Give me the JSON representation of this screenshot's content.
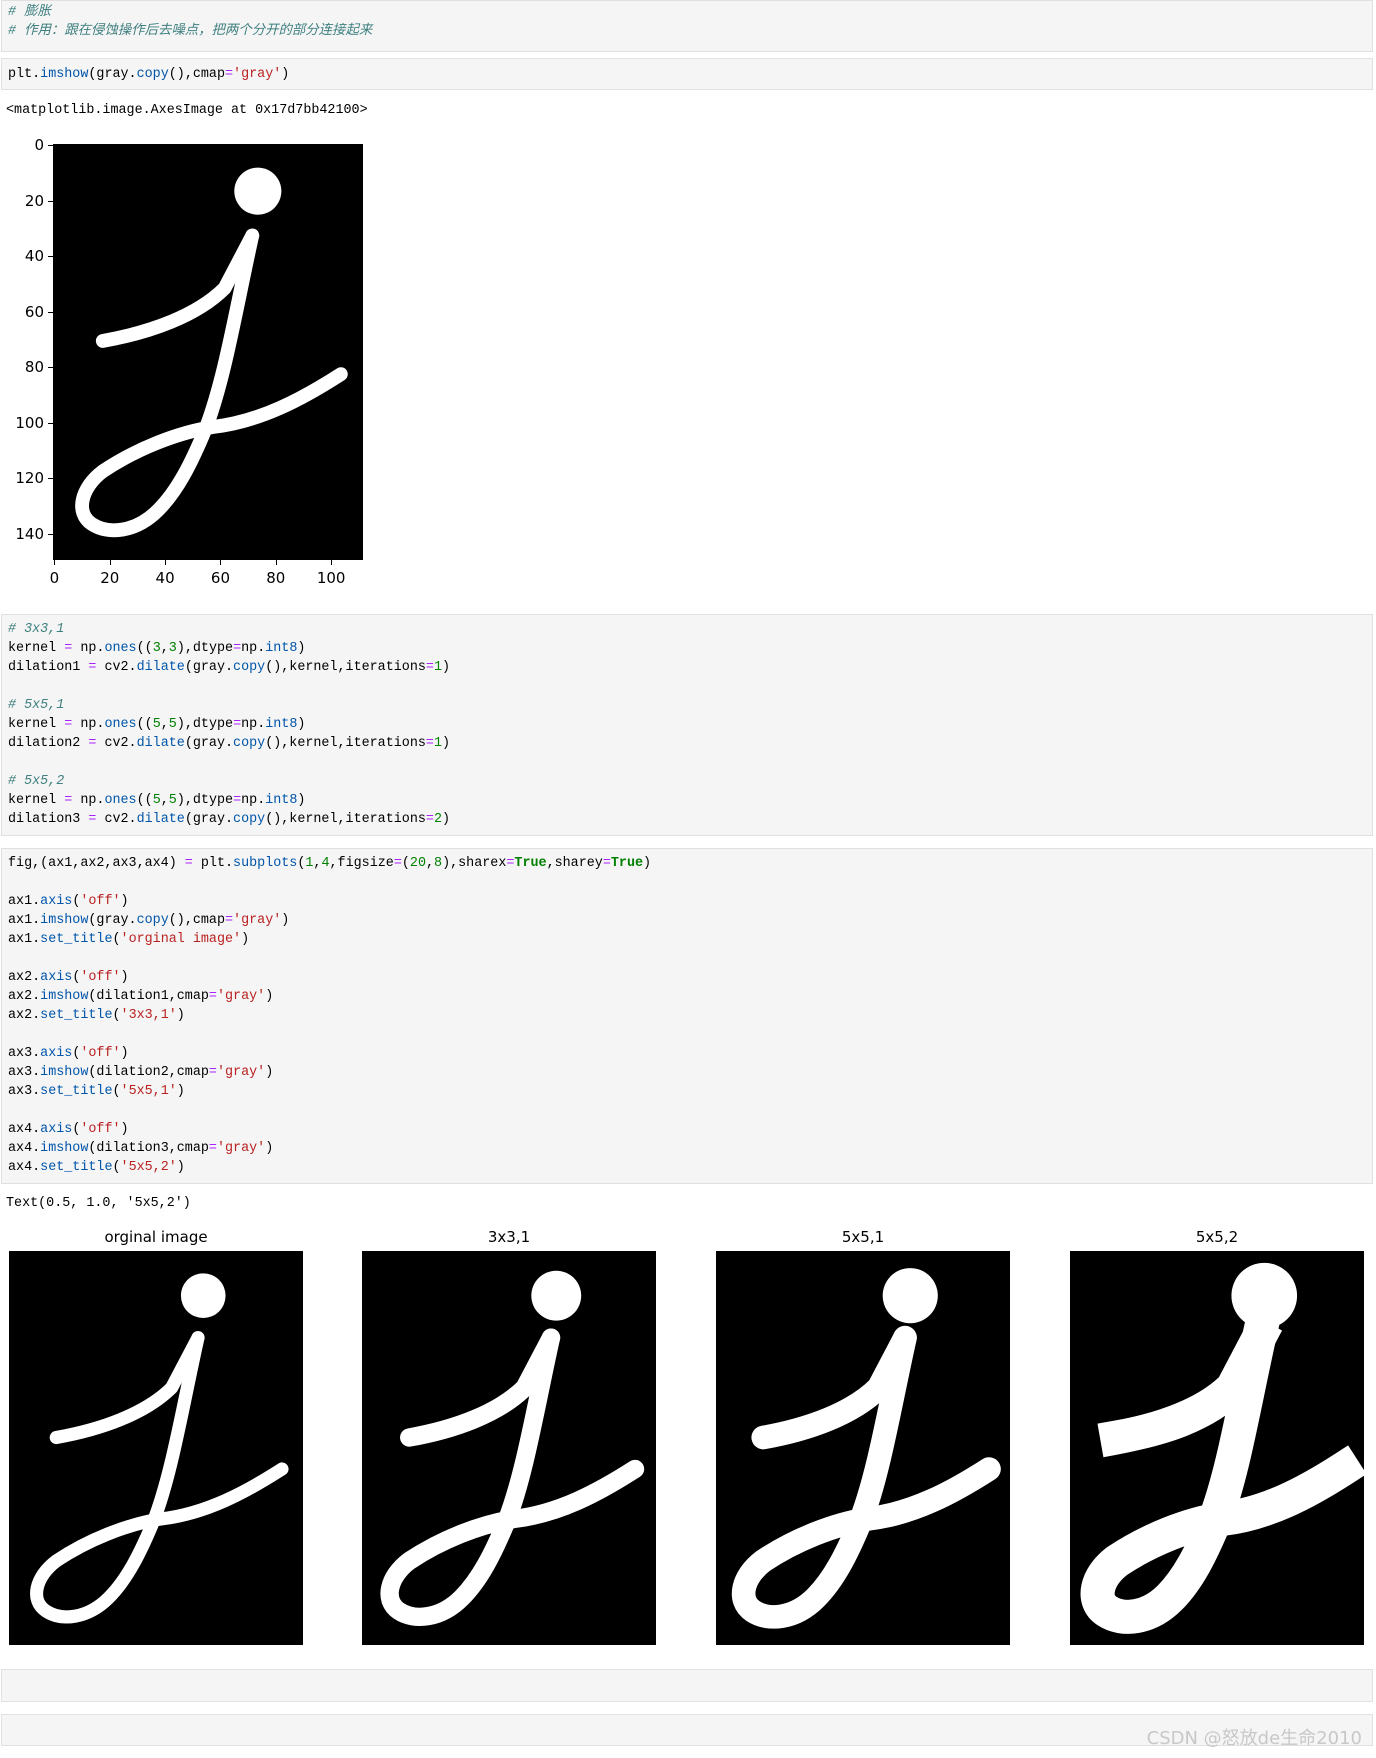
{
  "cells": [
    {
      "lines": [
        [
          [
            "cm",
            "# 膨胀"
          ]
        ],
        [
          [
            "cm",
            "# 作用：跟在侵蚀操作后去噪点，把两个分开的部分连接起来"
          ]
        ]
      ]
    },
    {
      "lines": [
        [
          [
            "tx",
            "plt."
          ],
          [
            "fn",
            "imshow"
          ],
          [
            "tx",
            "(gray."
          ],
          [
            "fn",
            "copy"
          ],
          [
            "tx",
            "(),cmap"
          ],
          [
            "op",
            "="
          ],
          [
            "st",
            "'gray'"
          ],
          [
            "tx",
            ")"
          ]
        ]
      ]
    },
    {
      "lines": [
        [
          [
            "cm",
            "# 3x3,1"
          ]
        ],
        [
          [
            "tx",
            "kernel "
          ],
          [
            "op",
            "="
          ],
          [
            "tx",
            " np."
          ],
          [
            "fn",
            "ones"
          ],
          [
            "tx",
            "(("
          ],
          [
            "nm",
            "3"
          ],
          [
            "tx",
            ","
          ],
          [
            "nm",
            "3"
          ],
          [
            "tx",
            "),dtype"
          ],
          [
            "op",
            "="
          ],
          [
            "tx",
            "np."
          ],
          [
            "fn",
            "int8"
          ],
          [
            "tx",
            ")"
          ]
        ],
        [
          [
            "tx",
            "dilation1 "
          ],
          [
            "op",
            "="
          ],
          [
            "tx",
            " cv2."
          ],
          [
            "fn",
            "dilate"
          ],
          [
            "tx",
            "(gray."
          ],
          [
            "fn",
            "copy"
          ],
          [
            "tx",
            "(),kernel,iterations"
          ],
          [
            "op",
            "="
          ],
          [
            "nm",
            "1"
          ],
          [
            "tx",
            ")"
          ]
        ],
        [],
        [
          [
            "cm",
            "# 5x5,1"
          ]
        ],
        [
          [
            "tx",
            "kernel "
          ],
          [
            "op",
            "="
          ],
          [
            "tx",
            " np."
          ],
          [
            "fn",
            "ones"
          ],
          [
            "tx",
            "(("
          ],
          [
            "nm",
            "5"
          ],
          [
            "tx",
            ","
          ],
          [
            "nm",
            "5"
          ],
          [
            "tx",
            "),dtype"
          ],
          [
            "op",
            "="
          ],
          [
            "tx",
            "np."
          ],
          [
            "fn",
            "int8"
          ],
          [
            "tx",
            ")"
          ]
        ],
        [
          [
            "tx",
            "dilation2 "
          ],
          [
            "op",
            "="
          ],
          [
            "tx",
            " cv2."
          ],
          [
            "fn",
            "dilate"
          ],
          [
            "tx",
            "(gray."
          ],
          [
            "fn",
            "copy"
          ],
          [
            "tx",
            "(),kernel,iterations"
          ],
          [
            "op",
            "="
          ],
          [
            "nm",
            "1"
          ],
          [
            "tx",
            ")"
          ]
        ],
        [],
        [
          [
            "cm",
            "# 5x5,2"
          ]
        ],
        [
          [
            "tx",
            "kernel "
          ],
          [
            "op",
            "="
          ],
          [
            "tx",
            " np."
          ],
          [
            "fn",
            "ones"
          ],
          [
            "tx",
            "(("
          ],
          [
            "nm",
            "5"
          ],
          [
            "tx",
            ","
          ],
          [
            "nm",
            "5"
          ],
          [
            "tx",
            "),dtype"
          ],
          [
            "op",
            "="
          ],
          [
            "tx",
            "np."
          ],
          [
            "fn",
            "int8"
          ],
          [
            "tx",
            ")"
          ]
        ],
        [
          [
            "tx",
            "dilation3 "
          ],
          [
            "op",
            "="
          ],
          [
            "tx",
            " cv2."
          ],
          [
            "fn",
            "dilate"
          ],
          [
            "tx",
            "(gray."
          ],
          [
            "fn",
            "copy"
          ],
          [
            "tx",
            "(),kernel,iterations"
          ],
          [
            "op",
            "="
          ],
          [
            "nm",
            "2"
          ],
          [
            "tx",
            ")"
          ]
        ]
      ]
    },
    {
      "lines": [
        [
          [
            "tx",
            "fig,(ax1,ax2,ax3,ax4) "
          ],
          [
            "op",
            "="
          ],
          [
            "tx",
            " plt."
          ],
          [
            "fn",
            "subplots"
          ],
          [
            "tx",
            "("
          ],
          [
            "nm",
            "1"
          ],
          [
            "tx",
            ","
          ],
          [
            "nm",
            "4"
          ],
          [
            "tx",
            ",figsize"
          ],
          [
            "op",
            "="
          ],
          [
            "tx",
            "("
          ],
          [
            "nm",
            "20"
          ],
          [
            "tx",
            ","
          ],
          [
            "nm",
            "8"
          ],
          [
            "tx",
            "),sharex"
          ],
          [
            "op",
            "="
          ],
          [
            "kw",
            "True"
          ],
          [
            "tx",
            ",sharey"
          ],
          [
            "op",
            "="
          ],
          [
            "kw",
            "True"
          ],
          [
            "tx",
            ")"
          ]
        ],
        [],
        [
          [
            "tx",
            "ax1."
          ],
          [
            "fn",
            "axis"
          ],
          [
            "tx",
            "("
          ],
          [
            "st",
            "'off'"
          ],
          [
            "tx",
            ")"
          ]
        ],
        [
          [
            "tx",
            "ax1."
          ],
          [
            "fn",
            "imshow"
          ],
          [
            "tx",
            "(gray."
          ],
          [
            "fn",
            "copy"
          ],
          [
            "tx",
            "(),cmap"
          ],
          [
            "op",
            "="
          ],
          [
            "st",
            "'gray'"
          ],
          [
            "tx",
            ")"
          ]
        ],
        [
          [
            "tx",
            "ax1."
          ],
          [
            "fn",
            "set_title"
          ],
          [
            "tx",
            "("
          ],
          [
            "st",
            "'orginal image'"
          ],
          [
            "tx",
            ")"
          ]
        ],
        [],
        [
          [
            "tx",
            "ax2."
          ],
          [
            "fn",
            "axis"
          ],
          [
            "tx",
            "("
          ],
          [
            "st",
            "'off'"
          ],
          [
            "tx",
            ")"
          ]
        ],
        [
          [
            "tx",
            "ax2."
          ],
          [
            "fn",
            "imshow"
          ],
          [
            "tx",
            "(dilation1,cmap"
          ],
          [
            "op",
            "="
          ],
          [
            "st",
            "'gray'"
          ],
          [
            "tx",
            ")"
          ]
        ],
        [
          [
            "tx",
            "ax2."
          ],
          [
            "fn",
            "set_title"
          ],
          [
            "tx",
            "("
          ],
          [
            "st",
            "'3x3,1'"
          ],
          [
            "tx",
            ")"
          ]
        ],
        [],
        [
          [
            "tx",
            "ax3."
          ],
          [
            "fn",
            "axis"
          ],
          [
            "tx",
            "("
          ],
          [
            "st",
            "'off'"
          ],
          [
            "tx",
            ")"
          ]
        ],
        [
          [
            "tx",
            "ax3."
          ],
          [
            "fn",
            "imshow"
          ],
          [
            "tx",
            "(dilation2,cmap"
          ],
          [
            "op",
            "="
          ],
          [
            "st",
            "'gray'"
          ],
          [
            "tx",
            ")"
          ]
        ],
        [
          [
            "tx",
            "ax3."
          ],
          [
            "fn",
            "set_title"
          ],
          [
            "tx",
            "("
          ],
          [
            "st",
            "'5x5,1'"
          ],
          [
            "tx",
            ")"
          ]
        ],
        [],
        [
          [
            "tx",
            "ax4."
          ],
          [
            "fn",
            "axis"
          ],
          [
            "tx",
            "("
          ],
          [
            "st",
            "'off'"
          ],
          [
            "tx",
            ")"
          ]
        ],
        [
          [
            "tx",
            "ax4."
          ],
          [
            "fn",
            "imshow"
          ],
          [
            "tx",
            "(dilation3,cmap"
          ],
          [
            "op",
            "="
          ],
          [
            "st",
            "'gray'"
          ],
          [
            "tx",
            ")"
          ]
        ],
        [
          [
            "tx",
            "ax4."
          ],
          [
            "fn",
            "set_title"
          ],
          [
            "tx",
            "("
          ],
          [
            "st",
            "'5x5,2'"
          ],
          [
            "tx",
            ")"
          ]
        ]
      ]
    }
  ],
  "outputs": {
    "axes_image": "<matplotlib.image.AxesImage at 0x17d7bb42100>",
    "text_repr": "Text(0.5, 1.0, '5x5,2')"
  },
  "plot1": {
    "yticks": [
      "0",
      "20",
      "40",
      "60",
      "80",
      "100",
      "120",
      "140"
    ],
    "xticks": [
      "0",
      "20",
      "40",
      "60",
      "80",
      "100"
    ]
  },
  "subplots": [
    {
      "title": "orginal image",
      "dilation": 0
    },
    {
      "title": "3x3,1",
      "dilation": 2
    },
    {
      "title": "5x5,1",
      "dilation": 4
    },
    {
      "title": "5x5,2",
      "dilation": 8
    }
  ],
  "watermark": "CSDN @怒放de生命2010"
}
